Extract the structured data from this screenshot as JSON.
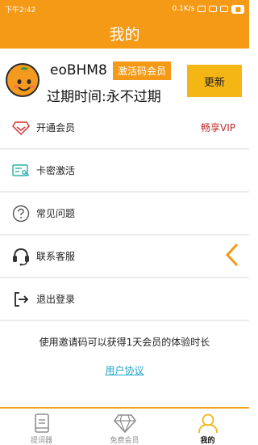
{
  "status_bar": {
    "time": "下午2:42",
    "speed": "0.1K/s"
  },
  "header": {
    "title": "我的"
  },
  "profile": {
    "username": "eoBHM8",
    "badge": "激活码会员",
    "expiry": "过期时间:永不过期",
    "refresh_label": "更新"
  },
  "menu": {
    "items": [
      {
        "label": "开通会员",
        "icon": "diamond-icon",
        "extra": "畅享VIP"
      },
      {
        "label": "卡密激活",
        "icon": "card-key-icon"
      },
      {
        "label": "常见问题",
        "icon": "question-icon"
      },
      {
        "label": "联系客服",
        "icon": "headset-icon"
      },
      {
        "label": "退出登录",
        "icon": "logout-icon"
      }
    ]
  },
  "footer": {
    "invite_text": "使用邀请码可以获得1天会员的体验时长",
    "agreement": "用户协议"
  },
  "bottom_nav": {
    "items": [
      {
        "label": "提词器",
        "icon": "teleprompter-icon"
      },
      {
        "label": "免费会员",
        "icon": "diamond-icon"
      },
      {
        "label": "我的",
        "icon": "user-icon",
        "active": true
      }
    ]
  },
  "colors": {
    "accent": "#f49a17",
    "refresh_button": "#f4b614",
    "vip_text": "#c2282b",
    "link": "#21a7c8"
  }
}
